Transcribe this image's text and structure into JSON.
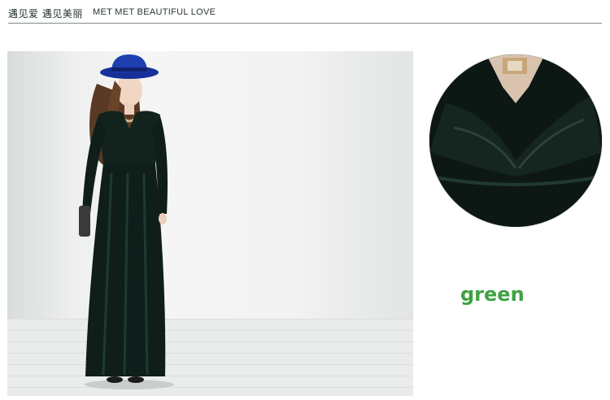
{
  "header": {
    "title_cn": "遇见爱 遇见美丽",
    "title_en": "MET MET BEAUTIFUL LOVE"
  },
  "product": {
    "color_label": "green",
    "color_label_hex": "#3fa142",
    "dress_color_hex": "#0f1e1a",
    "hat_color_hex": "#1e3fb0"
  },
  "images": {
    "main_photo": "model-in-green-velvet-maxi-dress",
    "closeup_photo": "velvet-neckline-detail-circle"
  }
}
